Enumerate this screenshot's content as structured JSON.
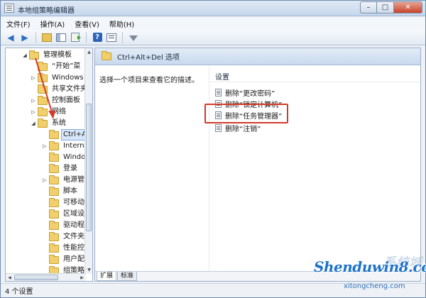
{
  "window": {
    "title": "本地组策略编辑器",
    "controls": {
      "minimize": "–",
      "maximize": "□",
      "close": "✕"
    }
  },
  "menu": [
    "文件(F)",
    "操作(A)",
    "查看(V)",
    "帮助(H)"
  ],
  "toolbar": {
    "icons": [
      "back-arrow-icon",
      "forward-arrow-icon",
      "up-folder-icon",
      "show-hide-tree-icon",
      "export-list-icon",
      "help-icon",
      "properties-icon",
      "filter-icon"
    ],
    "back": "◀",
    "forward": "▶",
    "help": "?"
  },
  "tree": {
    "items": [
      {
        "label": "管理模板",
        "expander": "◢",
        "depth": 0
      },
      {
        "label": "“开始”菜",
        "expander": "",
        "depth": 1
      },
      {
        "label": "Windows",
        "expander": "▷",
        "depth": 1
      },
      {
        "label": "共享文件夹",
        "expander": "",
        "depth": 1
      },
      {
        "label": "控制面板",
        "expander": "▷",
        "depth": 1
      },
      {
        "label": "网络",
        "expander": "▷",
        "depth": 1
      },
      {
        "label": "系统",
        "expander": "◢",
        "depth": 1
      },
      {
        "label": "Ctrl+A",
        "expander": "",
        "depth": 2,
        "selected": true
      },
      {
        "label": "Intern",
        "expander": "▷",
        "depth": 2
      },
      {
        "label": "Windo",
        "expander": "",
        "depth": 2
      },
      {
        "label": "登录",
        "expander": "",
        "depth": 2
      },
      {
        "label": "电源管",
        "expander": "▷",
        "depth": 2
      },
      {
        "label": "脚本",
        "expander": "",
        "depth": 2
      },
      {
        "label": "可移动",
        "expander": "",
        "depth": 2
      },
      {
        "label": "区域设",
        "expander": "",
        "depth": 2
      },
      {
        "label": "驱动程",
        "expander": "",
        "depth": 2
      },
      {
        "label": "文件夹",
        "expander": "",
        "depth": 2
      },
      {
        "label": "性能控",
        "expander": "",
        "depth": 2
      },
      {
        "label": "用户配",
        "expander": "",
        "depth": 2
      },
      {
        "label": "组策略",
        "expander": "",
        "depth": 2
      }
    ]
  },
  "content": {
    "header_title": "Ctrl+Alt+Del 选项",
    "description": "选择一个项目来查看它的描述。",
    "settings_header": "设置",
    "settings": [
      "删除“更改密码”",
      "删除“锁定计算机”",
      "删除“任务管理器”",
      "删除“注销”"
    ],
    "highlighted_index": 2,
    "tabs": {
      "extended": "扩展",
      "standard": "标准"
    }
  },
  "status": {
    "text": "4 个设置"
  },
  "watermark": {
    "main": "Shenduwin8.com",
    "sub": "xitongcheng.com",
    "ghost": "系统城"
  },
  "colors": {
    "highlight_box": "#d43a2a",
    "annotation_arrow": "#d43a2a",
    "watermark": "#1f73c8"
  }
}
